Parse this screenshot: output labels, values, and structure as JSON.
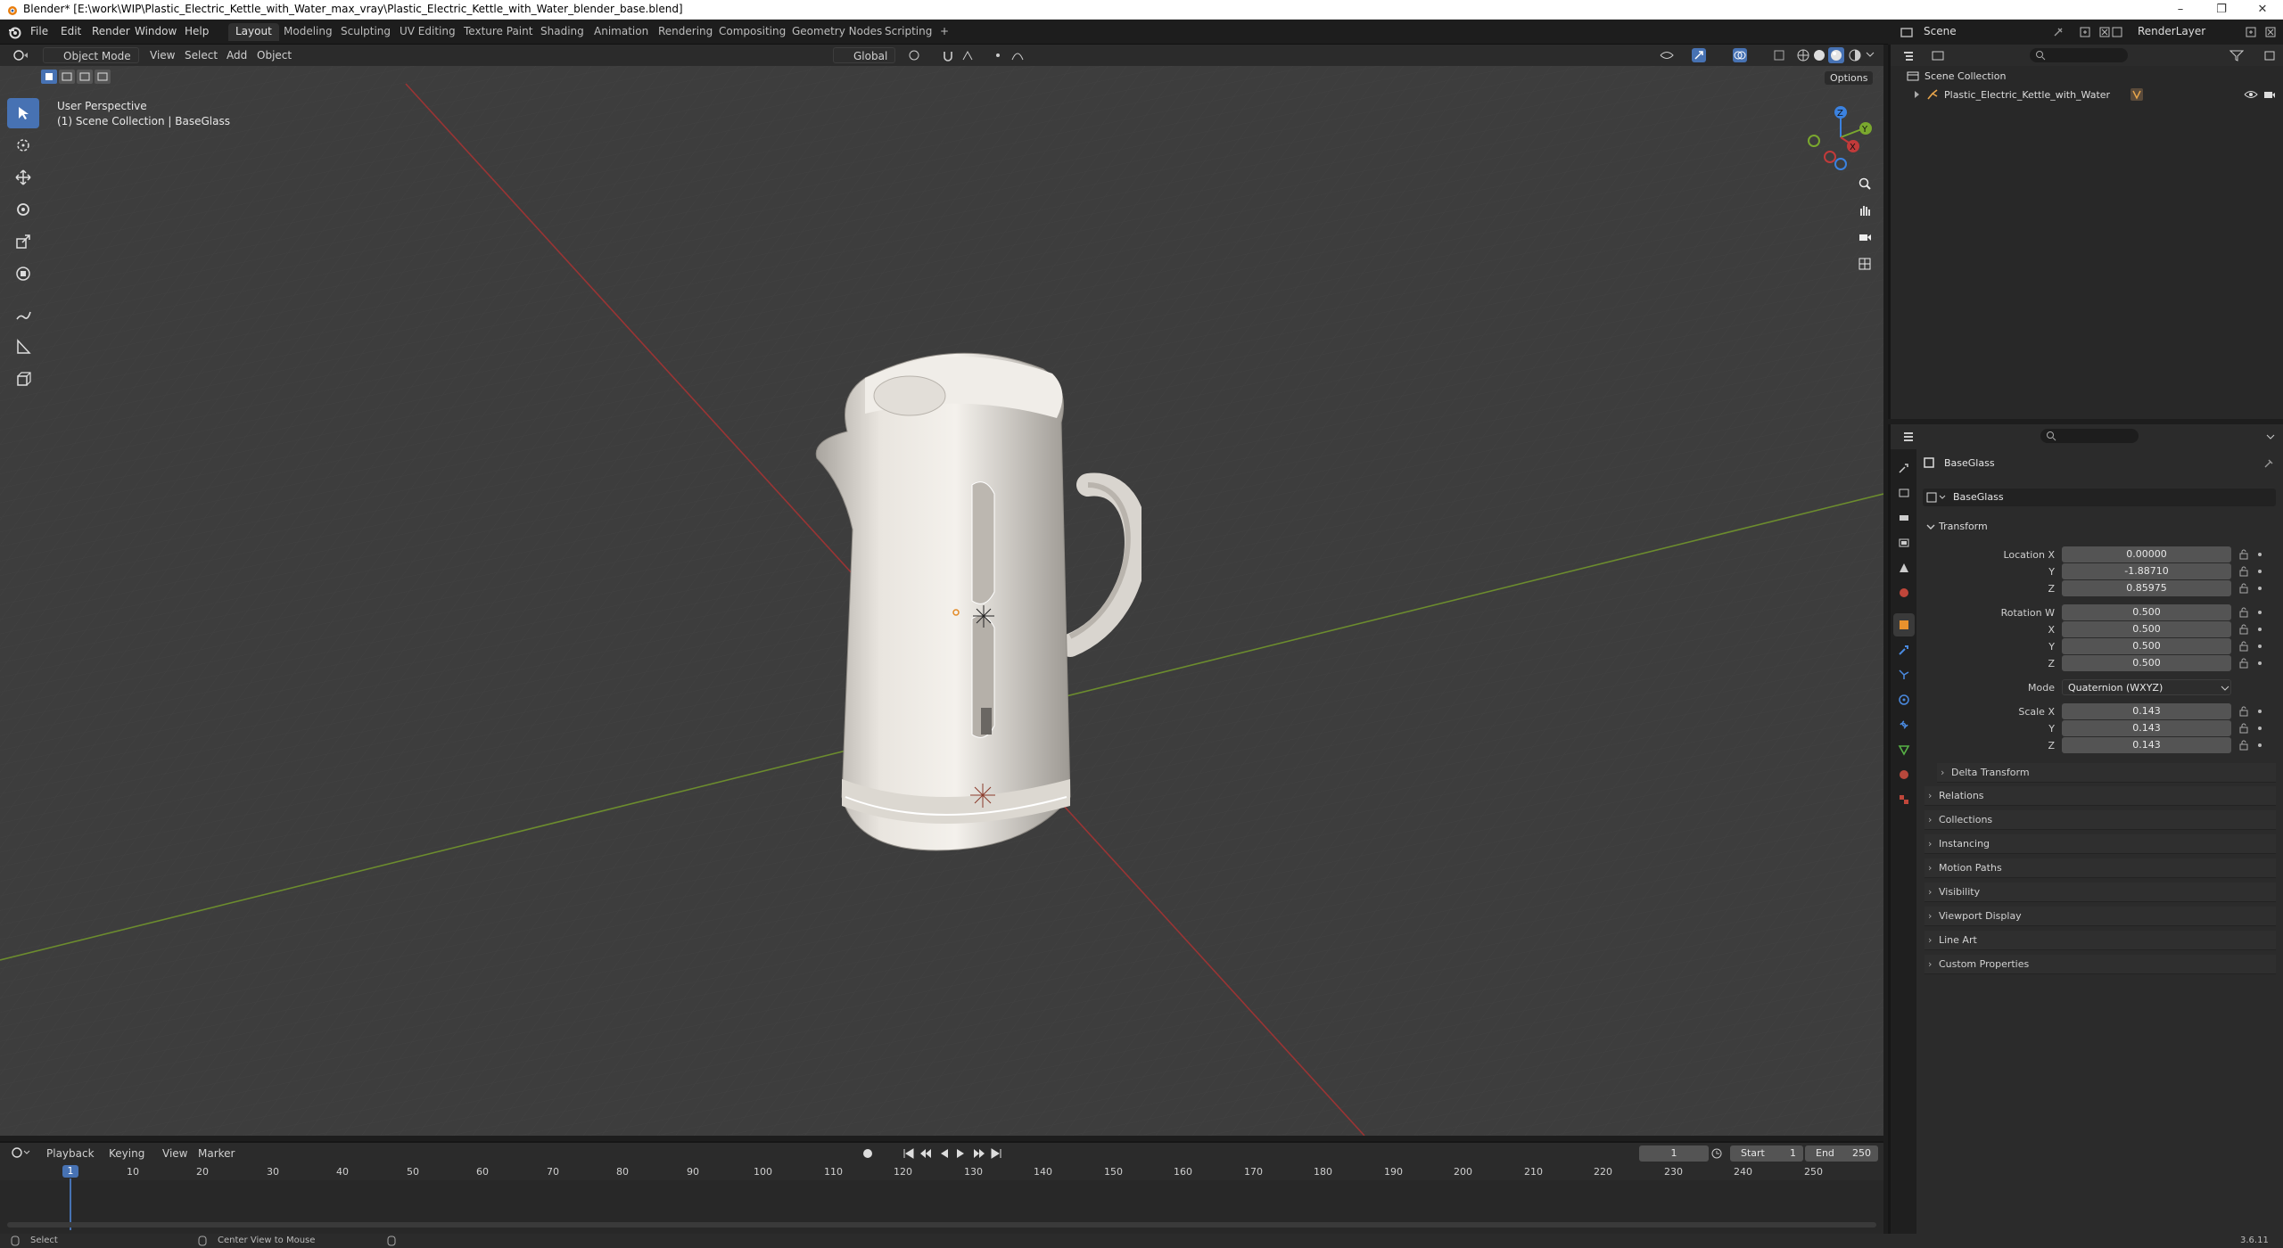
{
  "window": {
    "title": "Blender* [E:\\work\\WIP\\Plastic_Electric_Kettle_with_Water_max_vray\\Plastic_Electric_Kettle_with_Water_blender_base.blend]",
    "minimize": "–",
    "maximize": "❐",
    "close": "✕"
  },
  "menu": [
    "File",
    "Edit",
    "Render",
    "Window",
    "Help"
  ],
  "workspaces": [
    "Layout",
    "Modeling",
    "Sculpting",
    "UV Editing",
    "Texture Paint",
    "Shading",
    "Animation",
    "Rendering",
    "Compositing",
    "Geometry Nodes",
    "Scripting",
    "+"
  ],
  "scene": {
    "name": "Scene",
    "render_layer": "RenderLayer"
  },
  "viewport_header": {
    "mode": "Object Mode",
    "view": "View",
    "select": "Select",
    "add": "Add",
    "object": "Object",
    "orientation": "Global",
    "options": "Options"
  },
  "viewport": {
    "perspective": "User Perspective",
    "collection_info": "(1) Scene Collection | BaseGlass",
    "gizmo": {
      "z": "Z",
      "y": "Y",
      "x": "X"
    }
  },
  "outliner": {
    "root": "Scene Collection",
    "items": [
      {
        "label": "Plastic_Electric_Kettle_with_Water"
      }
    ]
  },
  "properties": {
    "object_name": "BaseGlass",
    "data_name": "BaseGlass",
    "transform_label": "Transform",
    "location": {
      "label": "Location X",
      "x": "0.00000",
      "y": "-1.88710",
      "z": "0.85975"
    },
    "rotation": {
      "label": "Rotation W",
      "w": "0.500",
      "x": "0.500",
      "y": "0.500",
      "z": "0.500"
    },
    "mode": {
      "label": "Mode",
      "value": "Quaternion (WXYZ)"
    },
    "scale": {
      "label": "Scale X",
      "x": "0.143",
      "y": "0.143",
      "z": "0.143"
    },
    "axis_labels": {
      "x": "X",
      "y": "Y",
      "z": "Z"
    },
    "delta_transform": "Delta Transform",
    "sections": [
      "Relations",
      "Collections",
      "Instancing",
      "Motion Paths",
      "Visibility",
      "Viewport Display",
      "Line Art",
      "Custom Properties"
    ]
  },
  "timeline": {
    "playback": "Playback",
    "keying": "Keying",
    "view": "View",
    "marker": "Marker",
    "current_frame": "1",
    "start_label": "Start",
    "start": "1",
    "end_label": "End",
    "end": "250",
    "frames": [
      "10",
      "20",
      "30",
      "40",
      "50",
      "60",
      "70",
      "80",
      "90",
      "100",
      "110",
      "120",
      "130",
      "140",
      "150",
      "160",
      "170",
      "180",
      "190",
      "200",
      "210",
      "220",
      "230",
      "240",
      "250"
    ],
    "playhead": "1"
  },
  "status": {
    "select": "Select",
    "center": "Center View to Mouse",
    "version": "3.6.11"
  },
  "colors": {
    "accent": "#4772b3",
    "x_axis": "#c13a3a",
    "y_axis": "#7aa82e",
    "z_axis": "#3b82e0",
    "playhead": "#4772b3"
  }
}
